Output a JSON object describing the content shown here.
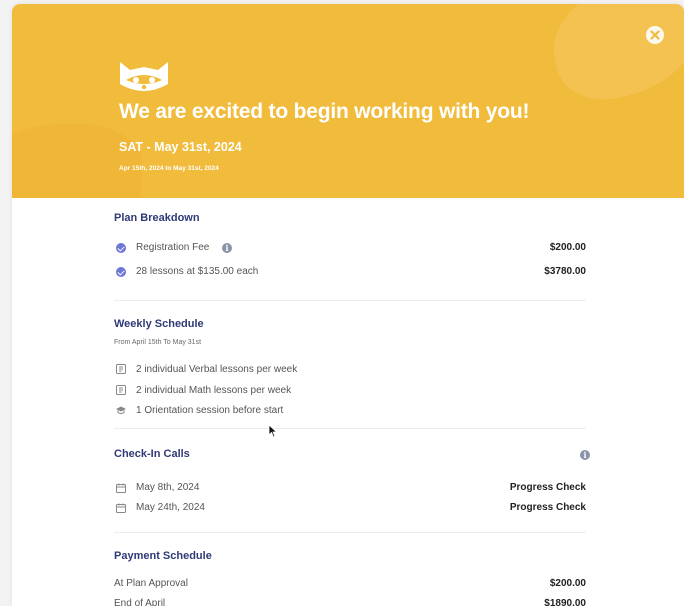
{
  "hero": {
    "title": "We are excited to begin working with you!",
    "date": "SAT - May 31st, 2024",
    "range": "Apr 15th, 2024 to May 31st, 2024",
    "logo_icon": "raccoon-logo-icon",
    "close_icon": "close-icon"
  },
  "plan": {
    "title": "Plan Breakdown",
    "items": [
      {
        "label": "Registration Fee",
        "value": "$200.00",
        "icon": "check-circle-icon",
        "has_info": true
      },
      {
        "label": "28 lessons at $135.00 each",
        "value": "$3780.00",
        "icon": "check-circle-icon",
        "has_info": false
      }
    ]
  },
  "schedule": {
    "title": "Weekly Schedule",
    "subtitle": "From April 15th To May 31st",
    "items": [
      {
        "label": "2 individual Verbal lessons per week",
        "icon": "lesson-book-icon"
      },
      {
        "label": "2 individual Math lessons per week",
        "icon": "lesson-book-icon"
      },
      {
        "label": "1 Orientation session before start",
        "icon": "graduation-cap-icon"
      }
    ]
  },
  "checkins": {
    "title": "Check-In Calls",
    "info_icon": "info-icon",
    "items": [
      {
        "date": "May 8th, 2024",
        "type": "Progress Check",
        "icon": "calendar-icon"
      },
      {
        "date": "May 24th, 2024",
        "type": "Progress Check",
        "icon": "calendar-icon"
      }
    ]
  },
  "payment": {
    "title": "Payment Schedule",
    "items": [
      {
        "label": "At Plan Approval",
        "value": "$200.00"
      },
      {
        "label": "End of April",
        "value": "$1890.00"
      }
    ]
  },
  "colors": {
    "hero_bg": "#f1bb3c",
    "section_title": "#2f3a76",
    "check_accent": "#6c76d6"
  }
}
